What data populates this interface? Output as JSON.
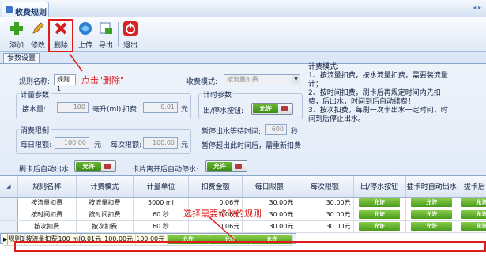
{
  "window": {
    "title": "收费规则",
    "nav": "◂ ▸"
  },
  "toolbar": {
    "buttons": [
      {
        "label": "添加",
        "icon": "add-icon"
      },
      {
        "label": "修改",
        "icon": "edit-icon"
      },
      {
        "label": "删除",
        "icon": "delete-icon"
      },
      {
        "label": "上传",
        "icon": "upload-icon"
      },
      {
        "label": "导出",
        "icon": "export-icon"
      },
      {
        "label": "退出",
        "icon": "exit-icon"
      }
    ]
  },
  "tab": {
    "label": "参数设置"
  },
  "form": {
    "rule_name_label": "规则名称:",
    "rule_name_value": "规则1",
    "hint_text": "点击\"删除\"",
    "mode_label": "收费模式:",
    "mode_value": "按流量扣费",
    "metering_group": "计量参数",
    "water_label": "接水量:",
    "water_value": "100",
    "water_unit": "毫升(ml)",
    "deduct_label": "扣费:",
    "deduct_value": "0.01",
    "deduct_unit": "元",
    "consume_group": "消费限制",
    "daily_label": "每日限额:",
    "daily_value": "100.00",
    "daily_unit": "元",
    "per_label": "每次限额:",
    "per_value": "100.00",
    "per_unit": "元",
    "timing_group": "计时参数",
    "outlet_label": "出/停水按钮:",
    "wait_label": "暂停出水等待时间:",
    "wait_value": "600",
    "wait_unit": "秒",
    "overtime_note": "暂停超出此时间后，需重新扣费",
    "card_swipe_label": "刷卡后自动出水:",
    "card_leave_label": "卡片离开后自动停水:",
    "toggle_on_text": "允许"
  },
  "help": {
    "title": "计费模式:",
    "lines": [
      "1、按流量扣费，按水流量扣费，需要装流量计；",
      "2、按时间扣费，刷卡后再规定时间内先扣费，后出水，时间到后自动续费！",
      "3、按次扣费，每刷一次卡出水一定时间，时间到后停止出水。"
    ]
  },
  "grid": {
    "columns": [
      "规则名称",
      "计费模式",
      "计量单位",
      "扣费金额",
      "每日限额",
      "每次限额",
      "出/停水按钮",
      "插卡时自动出水",
      "拔卡后自动"
    ],
    "rows": [
      [
        "按流量扣费",
        "按流量扣费",
        "5000 ml",
        "0.06元",
        "30.00元",
        "30.00元",
        "允许",
        "允许",
        "允许"
      ],
      [
        "按时间扣费",
        "按时间扣费",
        "60 秒",
        "0.06元",
        "30.00元",
        "30.00元",
        "允许",
        "允许",
        "允许"
      ],
      [
        "按次扣费",
        "按次扣费",
        "60 秒",
        "0.06元",
        "30.00元",
        "30.00元",
        "允许",
        "允许",
        "允许"
      ],
      [
        "规则1",
        "按流量扣费",
        "100 ml",
        "0.01元",
        "100.00元",
        "100.00元",
        "允许",
        "允许",
        "允许"
      ]
    ],
    "selected_row": 3,
    "annotation": "选择需要修改的规则"
  },
  "colors": {
    "accent_red": "#e01b1b",
    "allow_green": "#4a9b1d",
    "panel_bg": "#e2ebf7"
  }
}
